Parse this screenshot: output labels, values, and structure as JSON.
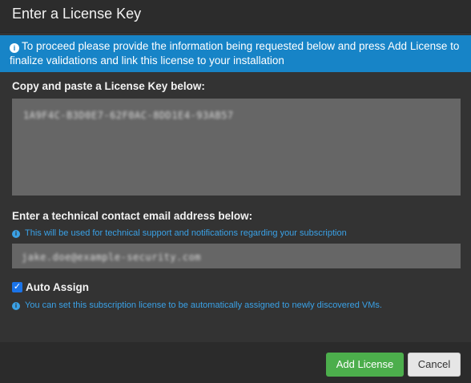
{
  "dialog": {
    "title": "Enter a License Key",
    "info_banner": "To proceed please provide the information being requested below and press Add License to finalize validations and link this license to your installation",
    "license_key": {
      "label": "Copy and paste a License Key below:",
      "value_obscured": "1A9F4C-B3D0E7-62F0AC-8DD1E4-93AB57"
    },
    "email": {
      "label": "Enter a technical contact email address below:",
      "hint": "This will be used for technical support and notifications regarding your subscription",
      "value_obscured": "jake.doe@example-security.com"
    },
    "auto_assign": {
      "label": "Auto Assign",
      "checked": true,
      "hint": "You can set this subscription license to be automatically assigned to newly discovered VMs."
    },
    "buttons": {
      "add_license": "Add License",
      "cancel": "Cancel"
    }
  },
  "colors": {
    "banner_bg": "#1784c7",
    "hint_text": "#3aa1e6",
    "primary_button": "#4cae4c"
  },
  "icons": {
    "info": "info-circle-icon",
    "check": "checkmark-icon"
  }
}
